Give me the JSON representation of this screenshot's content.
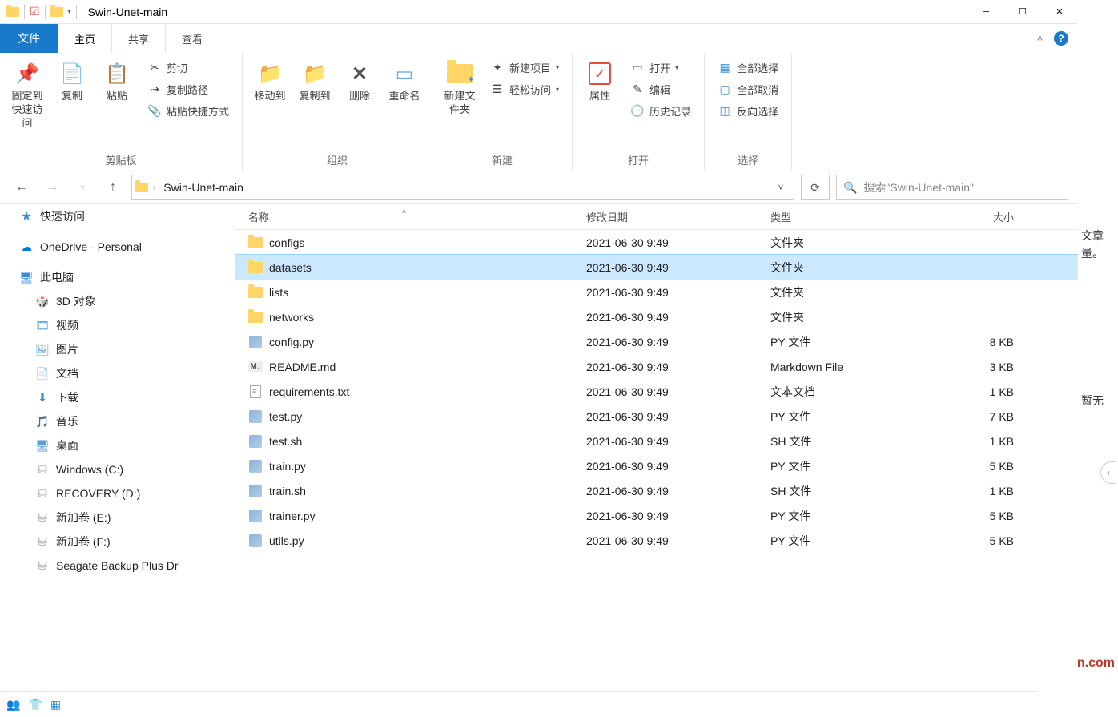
{
  "window": {
    "title": "Swin-Unet-main"
  },
  "tabs": {
    "file": "文件",
    "home": "主页",
    "share": "共享",
    "view": "查看"
  },
  "ribbon": {
    "clipboard": {
      "label": "剪贴板",
      "pin": "固定到快速访问",
      "copy": "复制",
      "paste": "粘贴",
      "cut": "剪切",
      "copy_path": "复制路径",
      "paste_shortcut": "粘贴快捷方式"
    },
    "organize": {
      "label": "组织",
      "move_to": "移动到",
      "copy_to": "复制到",
      "delete": "删除",
      "rename": "重命名"
    },
    "new": {
      "label": "新建",
      "new_folder": "新建文件夹",
      "new_item": "新建项目",
      "easy_access": "轻松访问"
    },
    "open": {
      "label": "打开",
      "properties": "属性",
      "open": "打开",
      "edit": "编辑",
      "history": "历史记录"
    },
    "select": {
      "label": "选择",
      "select_all": "全部选择",
      "select_none": "全部取消",
      "invert": "反向选择"
    }
  },
  "breadcrumb": {
    "current": "Swin-Unet-main"
  },
  "search": {
    "placeholder": "搜索\"Swin-Unet-main\""
  },
  "sidebar": {
    "quick_access": "快速访问",
    "onedrive": "OneDrive - Personal",
    "this_pc": "此电脑",
    "children": [
      {
        "label": "3D 对象",
        "icon": "3d"
      },
      {
        "label": "视频",
        "icon": "video"
      },
      {
        "label": "图片",
        "icon": "pictures"
      },
      {
        "label": "文档",
        "icon": "documents"
      },
      {
        "label": "下载",
        "icon": "downloads"
      },
      {
        "label": "音乐",
        "icon": "music"
      },
      {
        "label": "桌面",
        "icon": "desktop"
      },
      {
        "label": "Windows (C:)",
        "icon": "drive"
      },
      {
        "label": "RECOVERY (D:)",
        "icon": "drive"
      },
      {
        "label": "新加卷 (E:)",
        "icon": "drive"
      },
      {
        "label": "新加卷 (F:)",
        "icon": "drive"
      },
      {
        "label": "Seagate Backup Plus Dr",
        "icon": "drive"
      }
    ]
  },
  "columns": {
    "name": "名称",
    "date": "修改日期",
    "type": "类型",
    "size": "大小"
  },
  "files": [
    {
      "name": "configs",
      "date": "2021-06-30 9:49",
      "type": "文件夹",
      "size": "",
      "kind": "folder",
      "selected": false
    },
    {
      "name": "datasets",
      "date": "2021-06-30 9:49",
      "type": "文件夹",
      "size": "",
      "kind": "folder",
      "selected": true
    },
    {
      "name": "lists",
      "date": "2021-06-30 9:49",
      "type": "文件夹",
      "size": "",
      "kind": "folder",
      "selected": false
    },
    {
      "name": "networks",
      "date": "2021-06-30 9:49",
      "type": "文件夹",
      "size": "",
      "kind": "folder",
      "selected": false
    },
    {
      "name": "config.py",
      "date": "2021-06-30 9:49",
      "type": "PY 文件",
      "size": "8 KB",
      "kind": "py",
      "selected": false
    },
    {
      "name": "README.md",
      "date": "2021-06-30 9:49",
      "type": "Markdown File",
      "size": "3 KB",
      "kind": "md",
      "selected": false
    },
    {
      "name": "requirements.txt",
      "date": "2021-06-30 9:49",
      "type": "文本文档",
      "size": "1 KB",
      "kind": "txt",
      "selected": false
    },
    {
      "name": "test.py",
      "date": "2021-06-30 9:49",
      "type": "PY 文件",
      "size": "7 KB",
      "kind": "py",
      "selected": false
    },
    {
      "name": "test.sh",
      "date": "2021-06-30 9:49",
      "type": "SH 文件",
      "size": "1 KB",
      "kind": "py",
      "selected": false
    },
    {
      "name": "train.py",
      "date": "2021-06-30 9:49",
      "type": "PY 文件",
      "size": "5 KB",
      "kind": "py",
      "selected": false
    },
    {
      "name": "train.sh",
      "date": "2021-06-30 9:49",
      "type": "SH 文件",
      "size": "1 KB",
      "kind": "py",
      "selected": false
    },
    {
      "name": "trainer.py",
      "date": "2021-06-30 9:49",
      "type": "PY 文件",
      "size": "5 KB",
      "kind": "py",
      "selected": false
    },
    {
      "name": "utils.py",
      "date": "2021-06-30 9:49",
      "type": "PY 文件",
      "size": "5 KB",
      "kind": "py",
      "selected": false
    }
  ],
  "peek": {
    "text1": "文章",
    "text2": "量。",
    "text3": "暂无",
    "watermark": "Yuucn.com"
  }
}
